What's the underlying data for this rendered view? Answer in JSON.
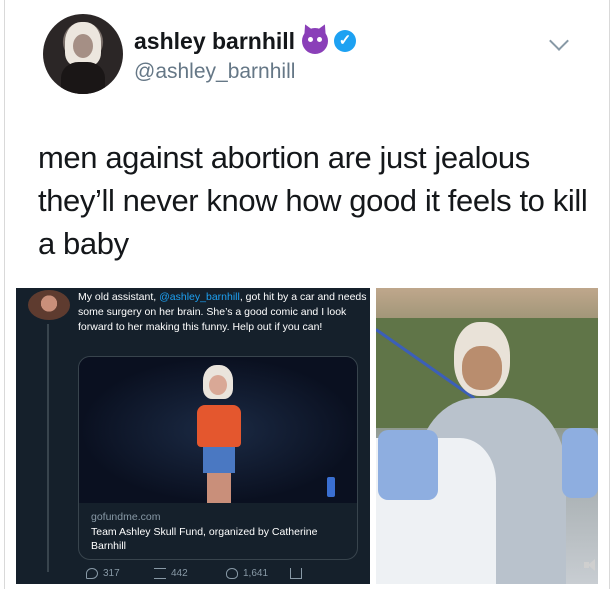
{
  "tweet": {
    "name": "ashley barnhill",
    "handle": "@ashley_barnhill",
    "text": "men against abortion are just jealous they’ll never know how good it feels to kill a baby",
    "badges": [
      "smiling-devil-icon",
      "verified-icon"
    ]
  },
  "embedded_tweet": {
    "text_before": "My old assistant, ",
    "mention": "@ashley_barnhill",
    "text_after": ", got hit by a car and needs some surgery on her brain. She’s a good comic and I look forward to her making this funny.  Help out if you can!",
    "card": {
      "domain": "gofundme.com",
      "title": "Team Ashley Skull Fund, organized by Catherine Barnhill"
    },
    "actions": {
      "replies": "317",
      "retweets": "442",
      "likes": "1,641"
    }
  },
  "colors": {
    "dark_bg": "#15202b",
    "link_blue": "#1da1f2",
    "verified_blue": "#1da1f2"
  }
}
